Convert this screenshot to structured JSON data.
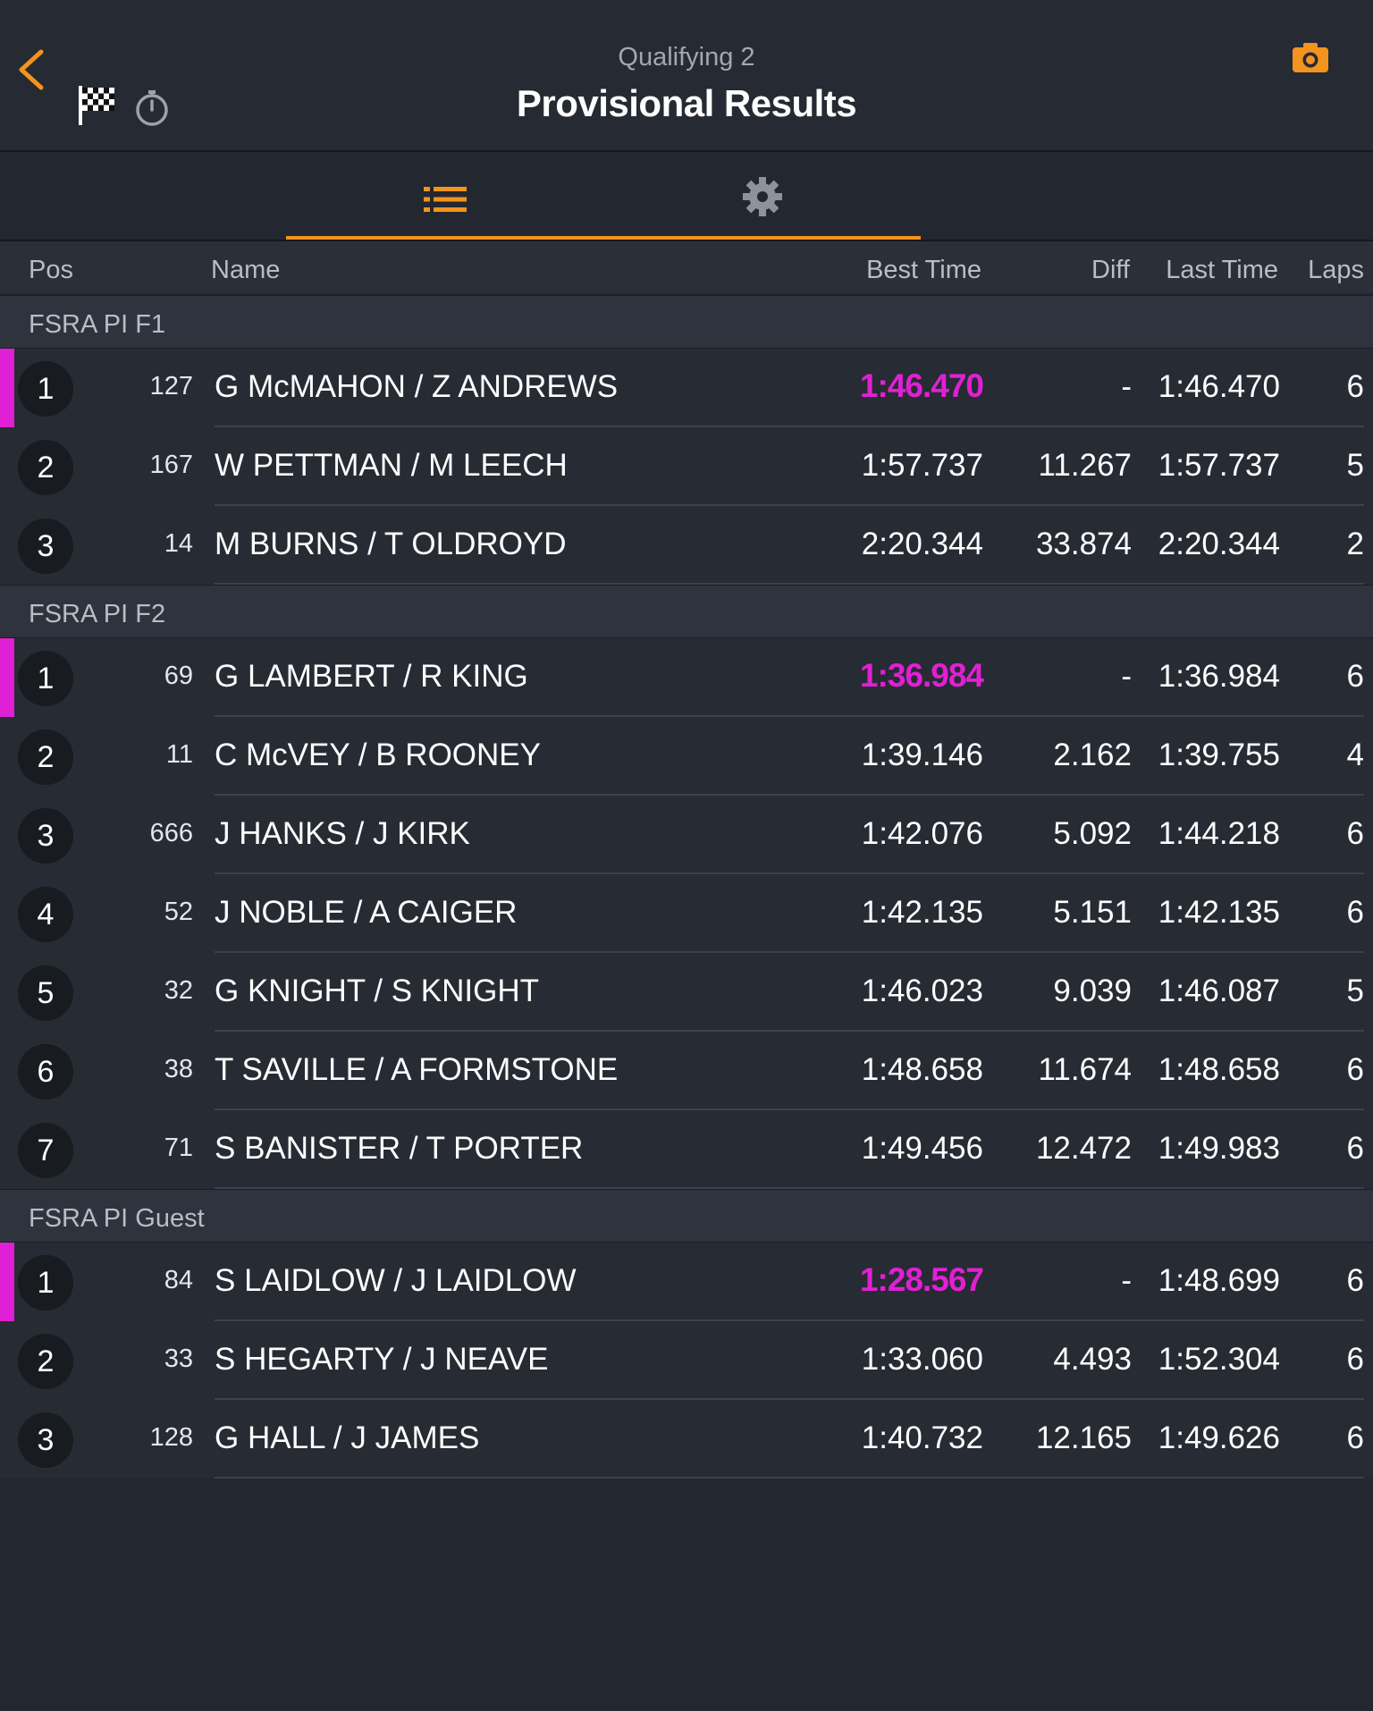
{
  "header": {
    "session": "Qualifying 2",
    "title": "Provisional Results"
  },
  "colors": {
    "accent": "#f39320",
    "fastest": "#e020d4",
    "background": "#23272f"
  },
  "icons": {
    "back": "chevron-left-icon",
    "flag": "checkered-flag-icon",
    "stopwatch": "stopwatch-icon",
    "camera": "camera-icon",
    "list": "list-icon",
    "settings": "gear-icon"
  },
  "columns": {
    "pos": "Pos",
    "name": "Name",
    "best": "Best Time",
    "diff": "Diff",
    "last": "Last Time",
    "laps": "Laps"
  },
  "groups": [
    {
      "name": "FSRA PI F1",
      "rows": [
        {
          "pos": "1",
          "car": "127",
          "name": "G McMAHON / Z ANDREWS",
          "best": "1:46.470",
          "diff": "-",
          "last": "1:46.470",
          "laps": "6",
          "fastest": true
        },
        {
          "pos": "2",
          "car": "167",
          "name": "W PETTMAN / M LEECH",
          "best": "1:57.737",
          "diff": "11.267",
          "last": "1:57.737",
          "laps": "5",
          "fastest": false
        },
        {
          "pos": "3",
          "car": "14",
          "name": "M BURNS / T OLDROYD",
          "best": "2:20.344",
          "diff": "33.874",
          "last": "2:20.344",
          "laps": "2",
          "fastest": false
        }
      ]
    },
    {
      "name": "FSRA PI F2",
      "rows": [
        {
          "pos": "1",
          "car": "69",
          "name": "G LAMBERT / R KING",
          "best": "1:36.984",
          "diff": "-",
          "last": "1:36.984",
          "laps": "6",
          "fastest": true
        },
        {
          "pos": "2",
          "car": "11",
          "name": "C McVEY / B ROONEY",
          "best": "1:39.146",
          "diff": "2.162",
          "last": "1:39.755",
          "laps": "4",
          "fastest": false
        },
        {
          "pos": "3",
          "car": "666",
          "name": "J HANKS / J KIRK",
          "best": "1:42.076",
          "diff": "5.092",
          "last": "1:44.218",
          "laps": "6",
          "fastest": false
        },
        {
          "pos": "4",
          "car": "52",
          "name": "J NOBLE / A CAIGER",
          "best": "1:42.135",
          "diff": "5.151",
          "last": "1:42.135",
          "laps": "6",
          "fastest": false
        },
        {
          "pos": "5",
          "car": "32",
          "name": "G KNIGHT / S KNIGHT",
          "best": "1:46.023",
          "diff": "9.039",
          "last": "1:46.087",
          "laps": "5",
          "fastest": false
        },
        {
          "pos": "6",
          "car": "38",
          "name": "T SAVILLE / A FORMSTONE",
          "best": "1:48.658",
          "diff": "11.674",
          "last": "1:48.658",
          "laps": "6",
          "fastest": false
        },
        {
          "pos": "7",
          "car": "71",
          "name": "S BANISTER / T PORTER",
          "best": "1:49.456",
          "diff": "12.472",
          "last": "1:49.983",
          "laps": "6",
          "fastest": false
        }
      ]
    },
    {
      "name": "FSRA PI Guest",
      "rows": [
        {
          "pos": "1",
          "car": "84",
          "name": "S LAIDLOW / J LAIDLOW",
          "best": "1:28.567",
          "diff": "-",
          "last": "1:48.699",
          "laps": "6",
          "fastest": true
        },
        {
          "pos": "2",
          "car": "33",
          "name": "S HEGARTY / J NEAVE",
          "best": "1:33.060",
          "diff": "4.493",
          "last": "1:52.304",
          "laps": "6",
          "fastest": false
        },
        {
          "pos": "3",
          "car": "128",
          "name": "G HALL / J JAMES",
          "best": "1:40.732",
          "diff": "12.165",
          "last": "1:49.626",
          "laps": "6",
          "fastest": false
        }
      ]
    }
  ]
}
